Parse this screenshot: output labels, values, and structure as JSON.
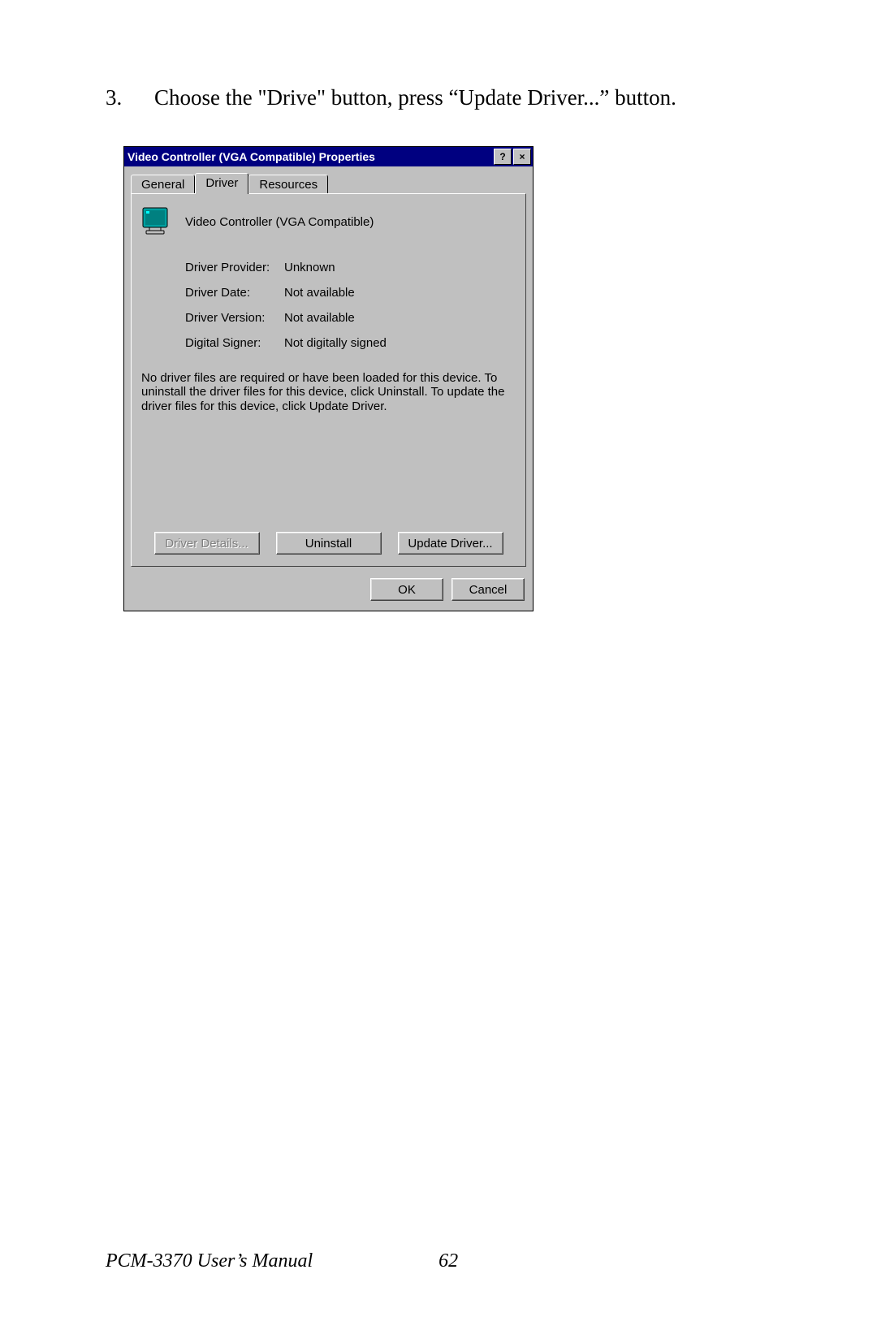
{
  "step": {
    "number": "3.",
    "text": "Choose the \"Drive\" button, press “Update Driver...” button."
  },
  "dialog": {
    "title": "Video Controller (VGA Compatible) Properties",
    "help_icon": "?",
    "close_icon": "×",
    "tabs": {
      "general": "General",
      "driver": "Driver",
      "resources": "Resources"
    },
    "device_name": "Video Controller (VGA Compatible)",
    "labels": {
      "provider": "Driver Provider:",
      "date": "Driver Date:",
      "version": "Driver Version:",
      "signer": "Digital Signer:"
    },
    "values": {
      "provider": "Unknown",
      "date": "Not available",
      "version": "Not available",
      "signer": "Not digitally signed"
    },
    "info_text": "No driver files are required or have been loaded for this device. To uninstall the driver files for this device, click Uninstall. To update the driver files for this device, click Update Driver.",
    "buttons": {
      "details": "Driver Details...",
      "uninstall": "Uninstall",
      "update": "Update Driver...",
      "ok": "OK",
      "cancel": "Cancel"
    }
  },
  "footer": {
    "manual": "PCM-3370 User’s Manual",
    "page": "62"
  }
}
